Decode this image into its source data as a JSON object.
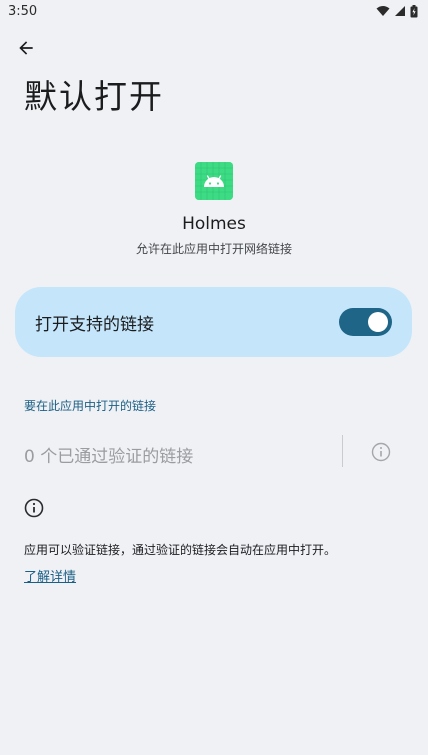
{
  "status_bar": {
    "time": "3:50"
  },
  "header": {
    "title": "默认打开"
  },
  "app": {
    "name": "Holmes",
    "description": "允许在此应用中打开网络链接"
  },
  "toggle": {
    "label": "打开支持的链接",
    "state": "on",
    "accent_color": "#1f6587",
    "card_color": "#c5e6fa"
  },
  "links_section": {
    "header": "要在此应用中打开的链接",
    "verified_count": "0 个已通过验证的链接"
  },
  "info": {
    "text": "应用可以验证链接，通过验证的链接会自动在应用中打开。",
    "learn_more": "了解详情"
  },
  "icons": {
    "back": "arrow-back-icon",
    "wifi": "wifi-icon",
    "signal": "signal-icon",
    "battery": "battery-icon",
    "info": "info-icon",
    "app": "android-icon"
  }
}
